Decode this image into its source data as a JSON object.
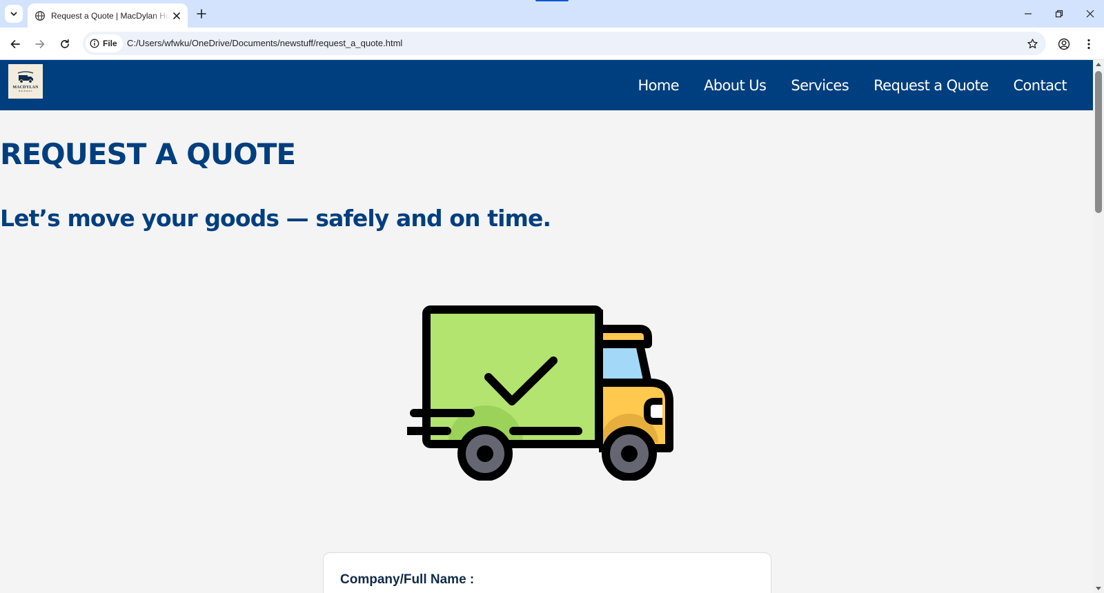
{
  "browser": {
    "tab_title": "Request a Quote | MacDylan Holdings",
    "address_chip": "File",
    "url": "C:/Users/wfwku/OneDrive/Documents/newstuff/request_a_quote.html"
  },
  "site": {
    "logo_name": "MACDYLAN",
    "logo_sub": "HOLDINGS",
    "nav": [
      "Home",
      "About Us",
      "Services",
      "Request a Quote",
      "Contact"
    ],
    "heading": "REQUEST A QUOTE",
    "tagline": "Let’s move your goods — safely and on time.",
    "form_first_label": "Company/Full Name :"
  },
  "colors": {
    "brand_navy": "#003f7f",
    "truck_body": "#b3e46f",
    "truck_cab": "#ffc84e",
    "truck_window": "#a4d8f8"
  }
}
